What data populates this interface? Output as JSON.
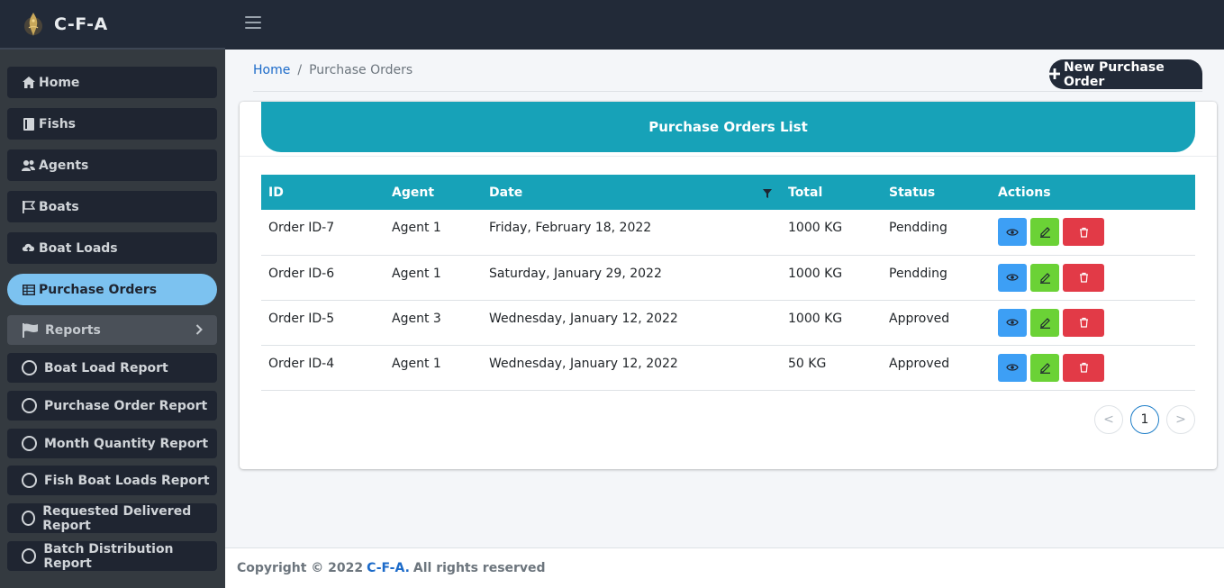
{
  "brand": {
    "name": "C-F-A"
  },
  "sidebar": {
    "items": [
      {
        "label": "Home",
        "icon": "home-icon"
      },
      {
        "label": "Fishs",
        "icon": "book-icon"
      },
      {
        "label": "Agents",
        "icon": "users-icon"
      },
      {
        "label": "Boats",
        "icon": "flag-icon"
      },
      {
        "label": "Boat Loads",
        "icon": "cloud-upload-icon"
      },
      {
        "label": "Purchase Orders",
        "icon": "table-icon",
        "active": true
      },
      {
        "label": "Reports",
        "icon": "flag-icon"
      }
    ],
    "reports": [
      {
        "label": "Boat Load Report"
      },
      {
        "label": "Purchase Order Report"
      },
      {
        "label": "Month Quantity Report"
      },
      {
        "label": "Fish Boat Loads Report"
      },
      {
        "label": "Requested Delivered Report"
      },
      {
        "label": "Batch Distribution Report"
      }
    ]
  },
  "breadcrumb": {
    "home": "Home",
    "separator": "/",
    "current": "Purchase Orders"
  },
  "toolbar": {
    "new_label": "New Purchase Order"
  },
  "card": {
    "title": "Purchase Orders List"
  },
  "table": {
    "headers": {
      "id": "ID",
      "agent": "Agent",
      "date": "Date",
      "total": "Total",
      "status": "Status",
      "actions": "Actions"
    },
    "rows": [
      {
        "id": "Order ID-7",
        "agent": "Agent 1",
        "date": "Friday, February 18, 2022",
        "total": "1000 KG",
        "status": "Pendding"
      },
      {
        "id": "Order ID-6",
        "agent": "Agent 1",
        "date": "Saturday, January 29, 2022",
        "total": "1000 KG",
        "status": "Pendding"
      },
      {
        "id": "Order ID-5",
        "agent": "Agent 3",
        "date": "Wednesday, January 12, 2022",
        "total": "1000 KG",
        "status": "Approved"
      },
      {
        "id": "Order ID-4",
        "agent": "Agent 1",
        "date": "Wednesday, January 12, 2022",
        "total": "50 KG",
        "status": "Approved"
      }
    ]
  },
  "pagination": {
    "prev": "<",
    "current": "1",
    "next": ">"
  },
  "footer": {
    "prefix": "Copyright © 2022",
    "brand": "C-F-A.",
    "suffix": "All rights reserved"
  },
  "colors": {
    "topbar": "#222a38",
    "sidebar": "#343a40",
    "accent": "#17a2b8",
    "active_nav": "#7cc2f0",
    "view": "#3d9ff5",
    "edit": "#6bd236",
    "delete": "#e23a47"
  }
}
